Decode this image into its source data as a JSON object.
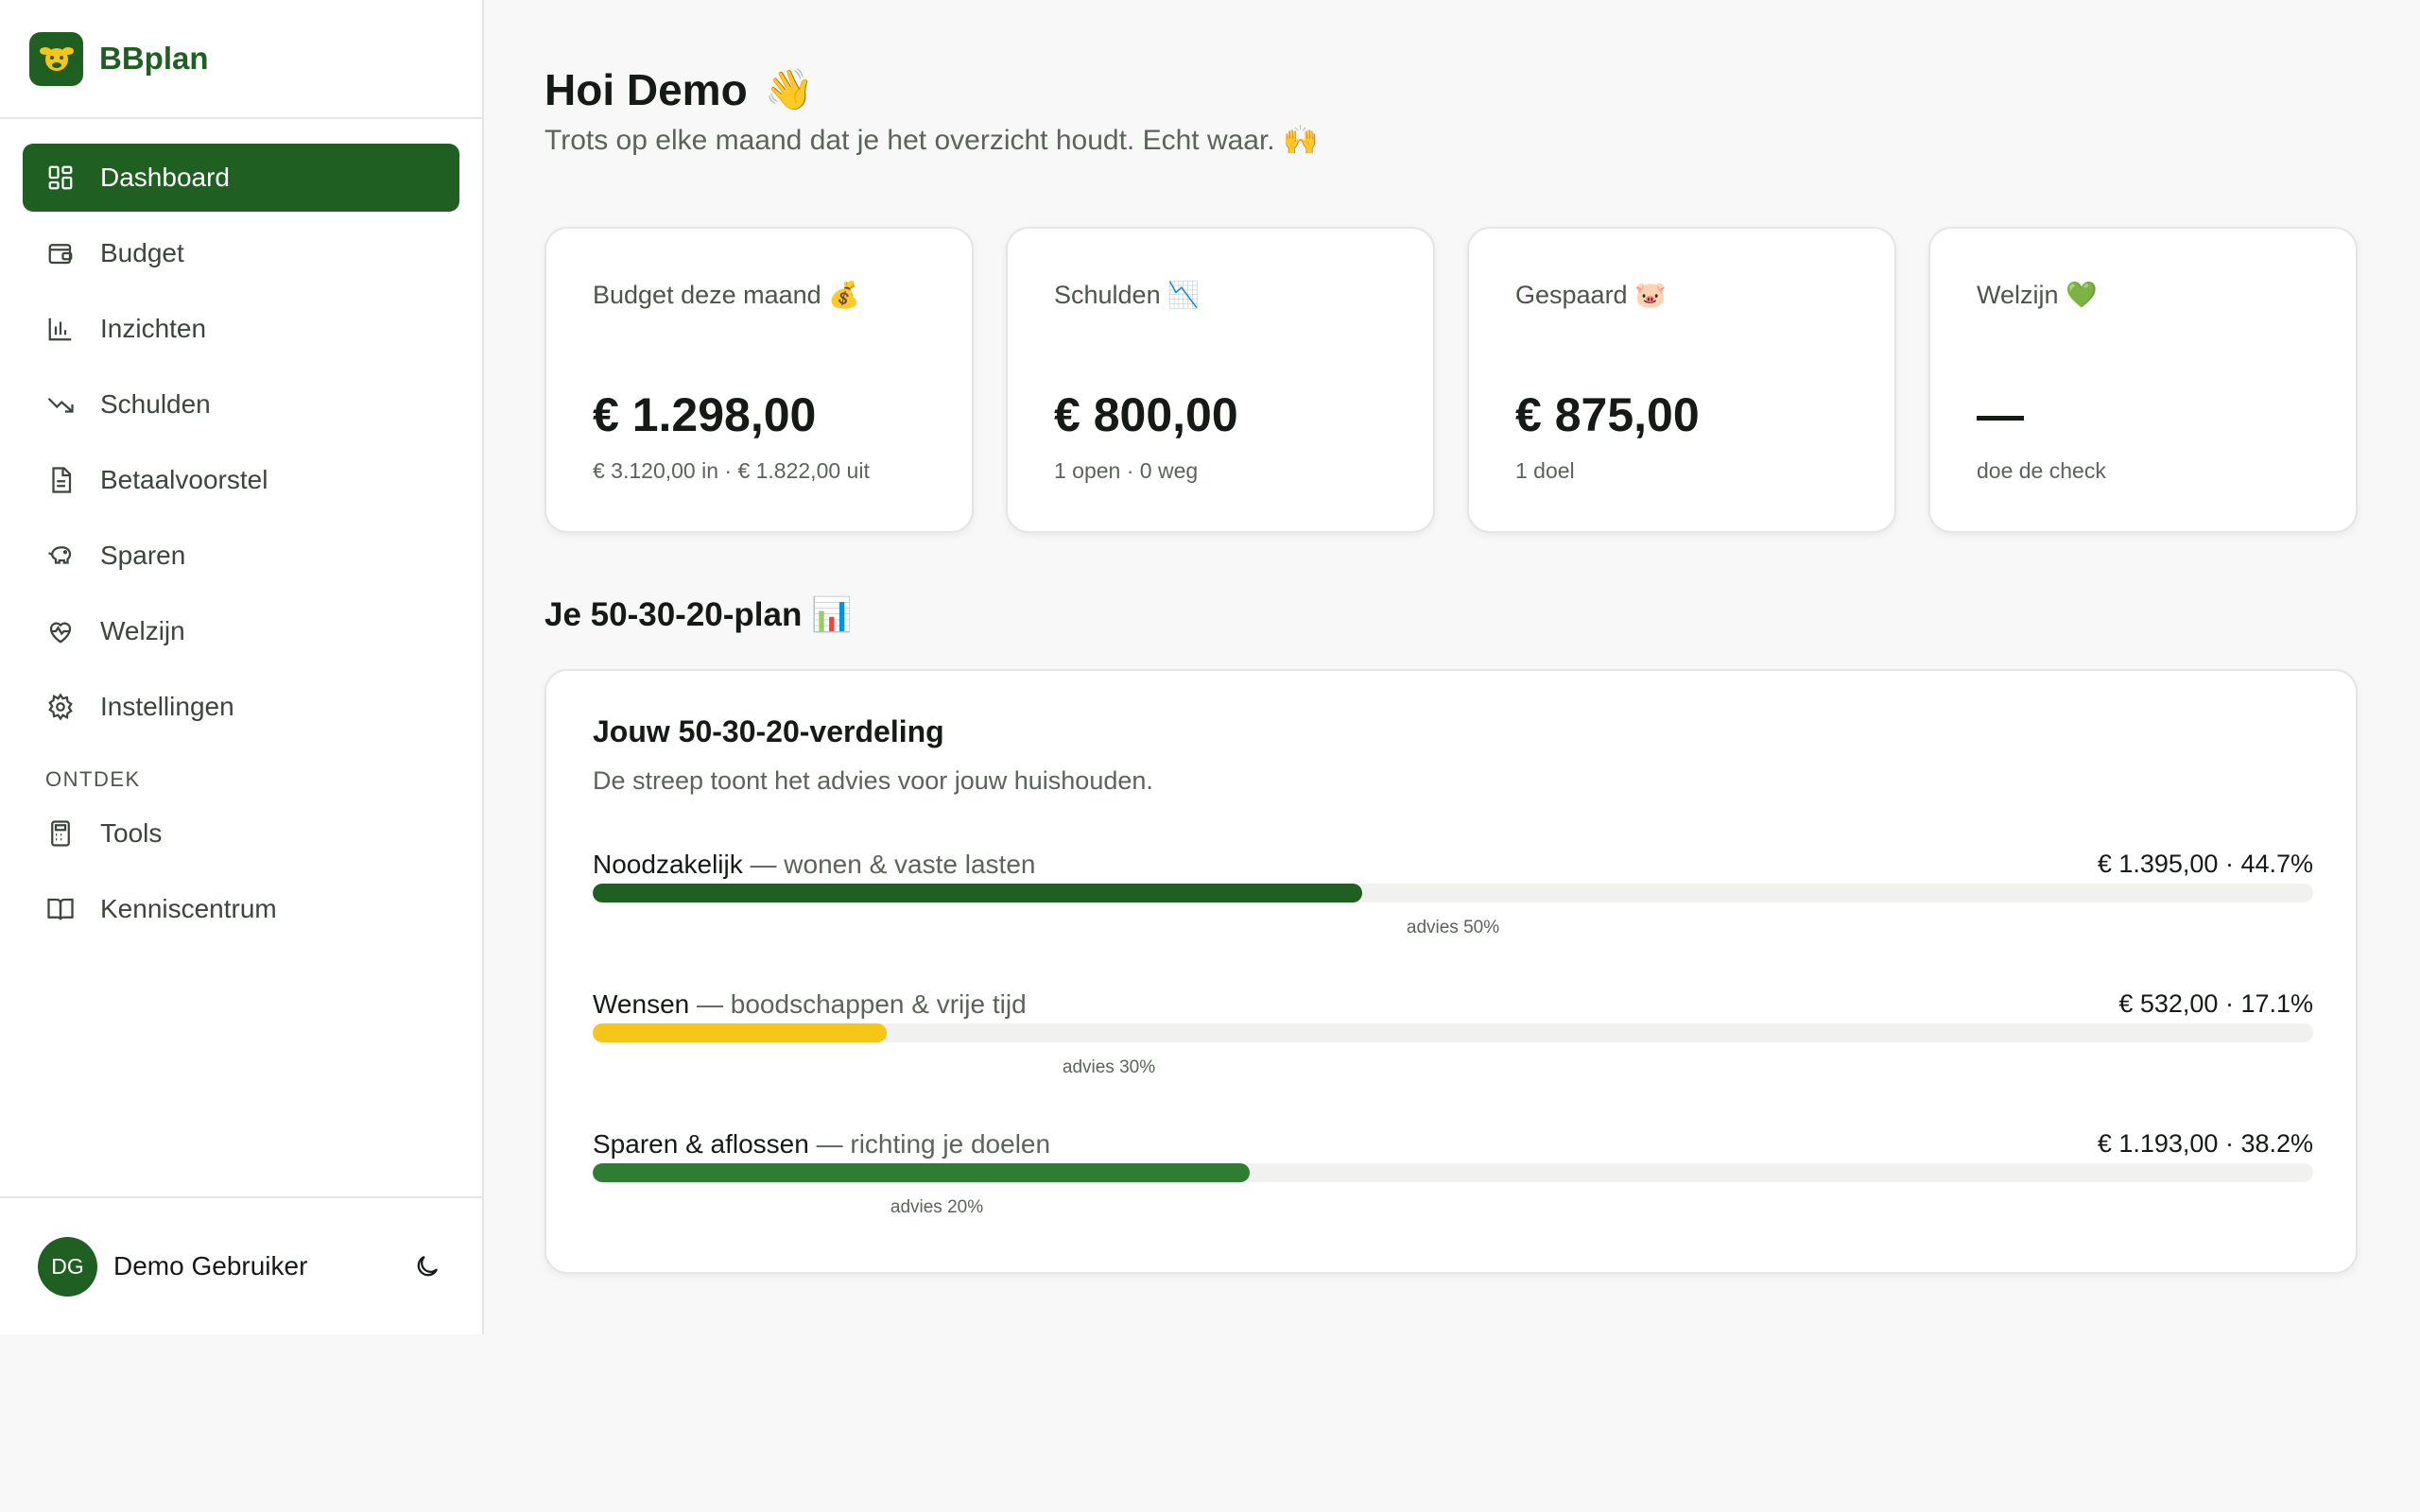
{
  "brand": {
    "name": "BBplan",
    "logo_icon": "sheep-icon"
  },
  "sidebar": {
    "items": [
      {
        "label": "Dashboard",
        "icon": "grid-icon",
        "active": true
      },
      {
        "label": "Budget",
        "icon": "wallet-icon"
      },
      {
        "label": "Inzichten",
        "icon": "bar-chart-icon"
      },
      {
        "label": "Schulden",
        "icon": "trending-down-icon"
      },
      {
        "label": "Betaalvoorstel",
        "icon": "document-icon"
      },
      {
        "label": "Sparen",
        "icon": "piggy-bank-icon"
      },
      {
        "label": "Welzijn",
        "icon": "heart-pulse-icon"
      },
      {
        "label": "Instellingen",
        "icon": "gear-icon"
      }
    ],
    "section_label": "ONTDEK",
    "explore_items": [
      {
        "label": "Tools",
        "icon": "calculator-icon"
      },
      {
        "label": "Kenniscentrum",
        "icon": "book-icon"
      }
    ],
    "user": {
      "initials": "DG",
      "name": "Demo Gebruiker",
      "theme_icon": "moon-icon"
    }
  },
  "header": {
    "greeting": "Hoi Demo",
    "greeting_emoji": "👋",
    "subtitle": "Trots op elke maand dat je het overzicht houdt. Echt waar. 🙌"
  },
  "cards": [
    {
      "title": "Budget deze maand 💰",
      "value": "€ 1.298,00",
      "sub": "€ 3.120,00 in · € 1.822,00 uit"
    },
    {
      "title": "Schulden 📉",
      "value": "€ 800,00",
      "sub": "1 open · 0 weg"
    },
    {
      "title": "Gespaard 🐷",
      "value": "€ 875,00",
      "sub": "1 doel"
    },
    {
      "title": "Welzijn 💚",
      "value": "—",
      "sub": "doe de check"
    }
  ],
  "plan": {
    "section_title": "Je 50-30-20-plan 📊",
    "title": "Jouw 50-30-20-verdeling",
    "description": "De streep toont het advies voor jouw huishouden.",
    "rows": [
      {
        "label": "Noodzakelijk",
        "note": " — wonen & vaste lasten",
        "amount": "€ 1.395,00 · 44.7%",
        "percent": 44.7,
        "advice_percent": 50,
        "advice_label": "advies 50%",
        "color": "#1f5f22"
      },
      {
        "label": "Wensen",
        "note": " — boodschappen & vrije tijd",
        "amount": "€ 532,00 · 17.1%",
        "percent": 17.1,
        "advice_percent": 30,
        "advice_label": "advies 30%",
        "color": "#f5c518"
      },
      {
        "label": "Sparen & aflossen",
        "note": " — richting je doelen",
        "amount": "€ 1.193,00 · 38.2%",
        "percent": 38.2,
        "advice_percent": 20,
        "advice_label": "advies 20%",
        "color": "#2e7d32"
      }
    ]
  }
}
